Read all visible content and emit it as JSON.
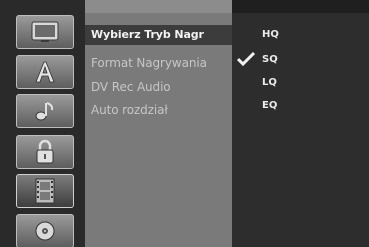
{
  "rail": {
    "items": [
      {
        "icon": "tv-icon"
      },
      {
        "icon": "letter-a-icon"
      },
      {
        "icon": "music-note-icon"
      },
      {
        "icon": "padlock-icon"
      },
      {
        "icon": "film-strip-icon",
        "active": true
      },
      {
        "icon": "disc-icon"
      }
    ]
  },
  "menu": {
    "items": [
      {
        "label": "Wybierz Tryb Nagr",
        "selected": true
      },
      {
        "label": "Format Nagrywania"
      },
      {
        "label": "DV Rec Audio"
      },
      {
        "label": "Auto rozdział"
      }
    ]
  },
  "options": {
    "items": [
      {
        "label": "HQ",
        "checked": false
      },
      {
        "label": "SQ",
        "checked": true
      },
      {
        "label": "LQ",
        "checked": false
      },
      {
        "label": "EQ",
        "checked": false
      }
    ]
  },
  "colors": {
    "background": "#1f1f1f",
    "menu_panel": "#7a7a7a",
    "selected_row": "#3c3c3c",
    "options_panel": "#2d2d2d",
    "text_light": "#f2f2f2",
    "text_dim": "#c6c6c6"
  }
}
